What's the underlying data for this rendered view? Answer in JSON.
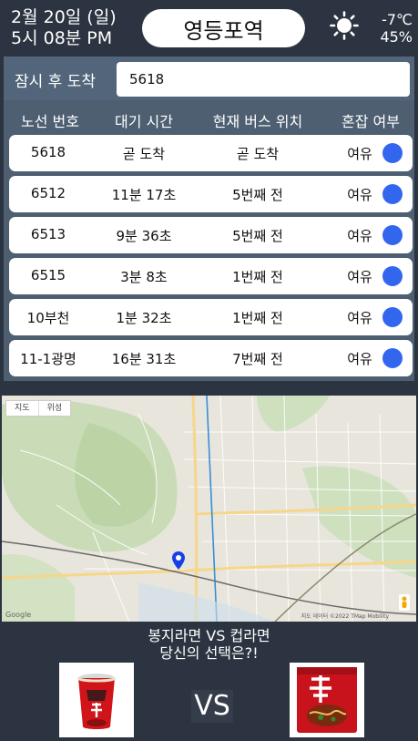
{
  "header": {
    "date": "2월 20일 (일)",
    "time": "5시 08분 PM",
    "station": "영등포역",
    "weather_icon": "sun-icon",
    "temperature": "-7℃",
    "humidity": "45%"
  },
  "arrival": {
    "label": "잠시 후 도착",
    "value": "5618"
  },
  "columns": [
    "노선 번호",
    "대기 시간",
    "현재 버스 위치",
    "혼잡 여부"
  ],
  "buses": [
    {
      "route": "5618",
      "wait": "곧 도착",
      "location": "곧 도착",
      "crowd": "여유"
    },
    {
      "route": "6512",
      "wait": "11분 17초",
      "location": "5번째 전",
      "crowd": "여유"
    },
    {
      "route": "6513",
      "wait": "9분 36초",
      "location": "5번째 전",
      "crowd": "여유"
    },
    {
      "route": "6515",
      "wait": "3분 8초",
      "location": "1번째 전",
      "crowd": "여유"
    },
    {
      "route": "10부천",
      "wait": "1분 32초",
      "location": "1번째 전",
      "crowd": "여유"
    },
    {
      "route": "11-1광명",
      "wait": "16분 31초",
      "location": "7번째 전",
      "crowd": "여유"
    }
  ],
  "map": {
    "tabs": [
      "지도",
      "위성"
    ],
    "logo": "Google",
    "attribution": "지도 데이터 ©2022 TMap Mobility"
  },
  "promo": {
    "line1": "봉지라면 VS 컵라면",
    "line2": "당신의 선택은?!",
    "vs": "VS"
  },
  "colors": {
    "background": "#2b3440",
    "panel": "#4e5f72",
    "crowd_ok": "#3366ee"
  }
}
